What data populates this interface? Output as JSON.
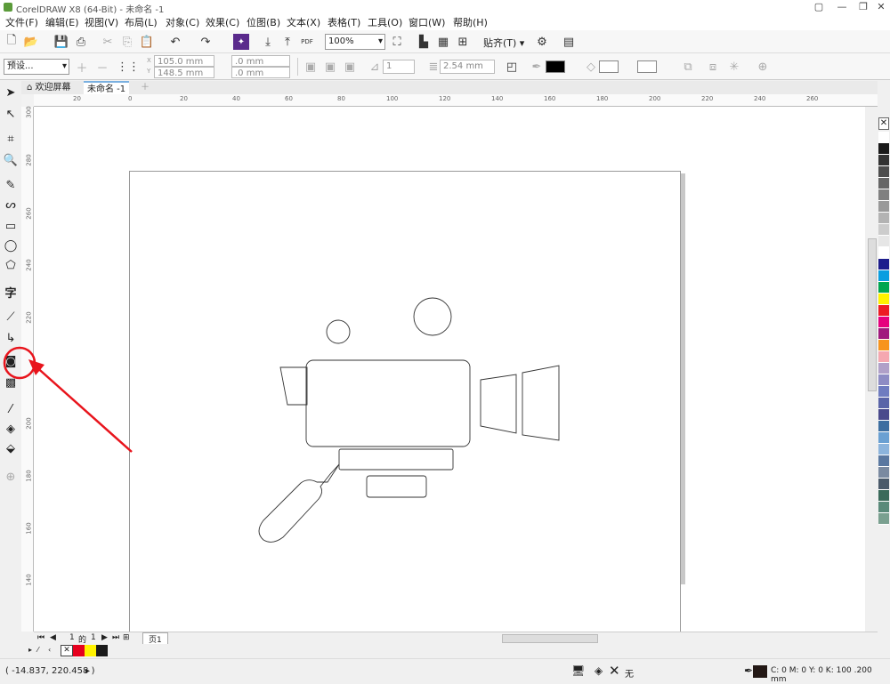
{
  "window": {
    "title": "CorelDRAW X8 (64-Bit) - 未命名 -1"
  },
  "menu": [
    "文件(F)",
    "编辑(E)",
    "视图(V)",
    "布局(L)",
    "对象(C)",
    "效果(C)",
    "位图(B)",
    "文本(X)",
    "表格(T)",
    "工具(O)",
    "窗口(W)",
    "帮助(H)"
  ],
  "toolbar": {
    "zoom": "100%",
    "snap_label": "贴齐(T)",
    "pdf_label": "PDF"
  },
  "propertybar": {
    "preset": "预设...",
    "width": "105.0 mm",
    "height": "148.5 mm",
    "dx": ".0 mm",
    "dy": ".0 mm",
    "copies": "1",
    "offset": "2.54 mm",
    "x_label": "X",
    "y_label": "Y"
  },
  "tabs": [
    {
      "label": "欢迎屏幕",
      "active": false
    },
    {
      "label": "未命名 -1",
      "active": true
    }
  ],
  "ruler": {
    "h_ticks": [
      "20",
      "0",
      "20",
      "40",
      "60",
      "80",
      "100",
      "120",
      "140",
      "160",
      "180",
      "200",
      "220",
      "240",
      "260"
    ],
    "v_ticks": [
      "300",
      "280",
      "260",
      "240",
      "220",
      "200",
      "180",
      "160",
      "140"
    ]
  },
  "page_nav": {
    "current": "1",
    "of_label": "的",
    "total": "1",
    "page_tab": "页1"
  },
  "status": {
    "coordinates": "( -14.837, 220.458 )",
    "fill_none": "无",
    "outline": "C: 0 M: 0 Y: 0 K: 100  .200 mm"
  },
  "palette_colors": [
    "#ffffff",
    "#1a1a1a",
    "#333333",
    "#4d4d4d",
    "#666666",
    "#808080",
    "#999999",
    "#b3b3b3",
    "#cccccc",
    "#e6e6e6",
    "#ffffff",
    "#1e1e8c",
    "#0a9ee0",
    "#00a650",
    "#fff200",
    "#ed1c24",
    "#e6007e",
    "#a0197d",
    "#f7941d",
    "#f5a7b0",
    "#b0a0c8",
    "#8e8cc4",
    "#6f7cc0",
    "#5a64a8",
    "#4a4a8c",
    "#3c6ea0",
    "#6aa0d2",
    "#8cb4dc",
    "#5a78a0",
    "#7a8aa0",
    "#4a5a6a",
    "#3a6a5a",
    "#5a8a7a",
    "#7aa090"
  ],
  "doc_palette": [
    "none",
    "#e6001e",
    "#fff200",
    "#1a1a1a"
  ],
  "accent": {
    "annotation": "#e8141c"
  }
}
